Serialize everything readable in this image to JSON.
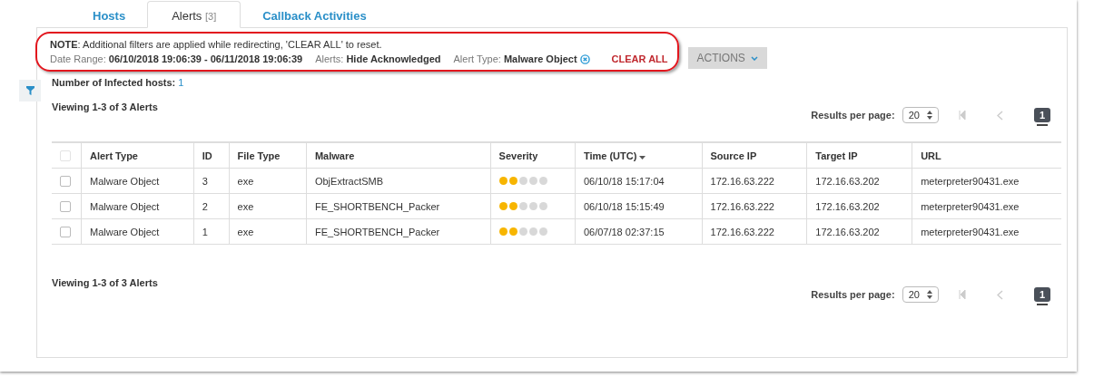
{
  "tabs": [
    {
      "label": "Hosts",
      "selected": false
    },
    {
      "label": "Alerts",
      "count": "[3]",
      "selected": true
    },
    {
      "label": "Callback Activities",
      "selected": false
    }
  ],
  "note": {
    "label": "NOTE",
    "text": ": Additional filters are applied while redirecting, 'CLEAR ALL' to reset."
  },
  "filters": [
    {
      "label": "Date Range:",
      "value": "06/10/2018 19:06:39 - 06/11/2018 19:06:39",
      "removable": false
    },
    {
      "label": "Alerts:",
      "value": "Hide Acknowledged",
      "removable": false
    },
    {
      "label": "Alert Type:",
      "value": "Malware Object",
      "removable": true
    }
  ],
  "clear_all": "CLEAR ALL",
  "actions": "ACTIONS",
  "infected": {
    "label": "Number of Infected hosts:",
    "value": "1"
  },
  "viewing_top": "Viewing 1-3 of 3 Alerts",
  "viewing_bottom": "Viewing 1-3 of 3 Alerts",
  "pagers": [
    {
      "label": "Results per page:",
      "per_page": "20",
      "page": "1"
    },
    {
      "label": "Results per page:",
      "per_page": "20",
      "page": "1"
    }
  ],
  "table": {
    "select_all": {
      "checked": false,
      "disabled": true
    },
    "columns": [
      {
        "label": "Alert Type",
        "sorted": false
      },
      {
        "label": "ID",
        "sorted": false
      },
      {
        "label": "File Type",
        "sorted": false
      },
      {
        "label": "Malware",
        "sorted": false
      },
      {
        "label": "Severity",
        "sorted": false
      },
      {
        "label": "Time (UTC)",
        "sorted": true
      },
      {
        "label": "Source IP",
        "sorted": false
      },
      {
        "label": "Target IP",
        "sorted": false
      },
      {
        "label": "URL",
        "sorted": false
      }
    ],
    "rows": [
      {
        "checked": false,
        "alert_type": "Malware Object",
        "id": "3",
        "file_type": "exe",
        "malware": "ObjExtractSMB",
        "stars": 2,
        "time": "06/10/18 15:17:04",
        "source_ip": "172.16.63.222",
        "target_ip": "172.16.63.202",
        "url": "meterpreter90431.exe"
      },
      {
        "checked": false,
        "alert_type": "Malware Object",
        "id": "2",
        "file_type": "exe",
        "malware": "FE_SHORTBENCH_Packer",
        "stars": 2,
        "time": "06/10/18 15:15:49",
        "source_ip": "172.16.63.222",
        "target_ip": "172.16.63.202",
        "url": "meterpreter90431.exe"
      },
      {
        "checked": false,
        "alert_type": "Malware Object",
        "id": "1",
        "file_type": "exe",
        "malware": "FE_SHORTBENCH_Packer",
        "stars": 2,
        "time": "06/07/18 02:37:15",
        "source_ip": "172.16.63.222",
        "target_ip": "172.16.63.202",
        "url": "meterpreter90431.exe"
      }
    ]
  }
}
